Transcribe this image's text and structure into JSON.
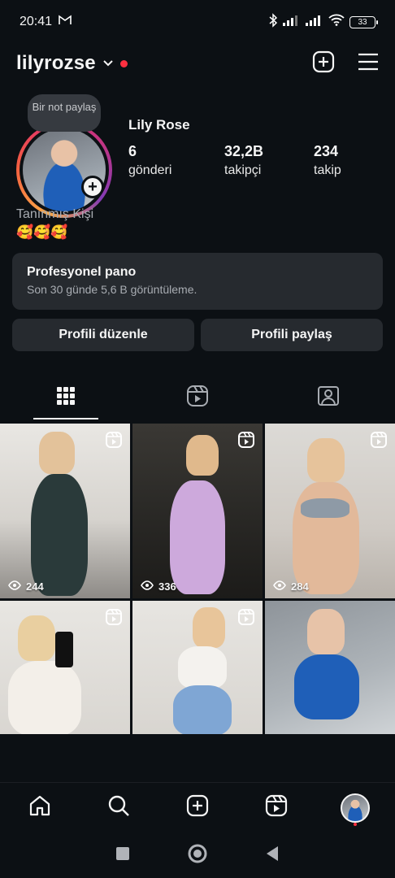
{
  "status_bar": {
    "time": "20:41",
    "battery": "33"
  },
  "header": {
    "username": "lilyrozse"
  },
  "profile": {
    "note_placeholder": "Bir not paylaş",
    "display_name": "Lily Rose",
    "stats": [
      {
        "value": "6",
        "label": "gönderi"
      },
      {
        "value": "32,2B",
        "label": "takipçi"
      },
      {
        "value": "234",
        "label": "takip"
      }
    ],
    "category": "Tanınmış Kişi",
    "bio": "🥰🥰🥰"
  },
  "dashboard": {
    "title": "Profesyonel pano",
    "subtitle": "Son 30 günde 5,6 B görüntüleme."
  },
  "buttons": {
    "edit_profile": "Profili düzenle",
    "share_profile": "Profili paylaş"
  },
  "tabs": [
    {
      "icon": "grid-icon",
      "active": true
    },
    {
      "icon": "reels-icon",
      "active": false
    },
    {
      "icon": "tagged-icon",
      "active": false
    }
  ],
  "posts": [
    {
      "type": "reel",
      "views": "244"
    },
    {
      "type": "reel",
      "views": "336"
    },
    {
      "type": "reel",
      "views": "284"
    },
    {
      "type": "reel",
      "views": ""
    },
    {
      "type": "reel",
      "views": ""
    },
    {
      "type": "photo",
      "views": ""
    }
  ],
  "bottom_nav": [
    "home-icon",
    "search-icon",
    "create-icon",
    "reels-icon",
    "profile-avatar"
  ],
  "colors": {
    "background": "#0c1014",
    "surface": "#262a2f",
    "notification_red": "#ff3040",
    "text": "#f5f5f5",
    "muted": "#a8acb2"
  }
}
